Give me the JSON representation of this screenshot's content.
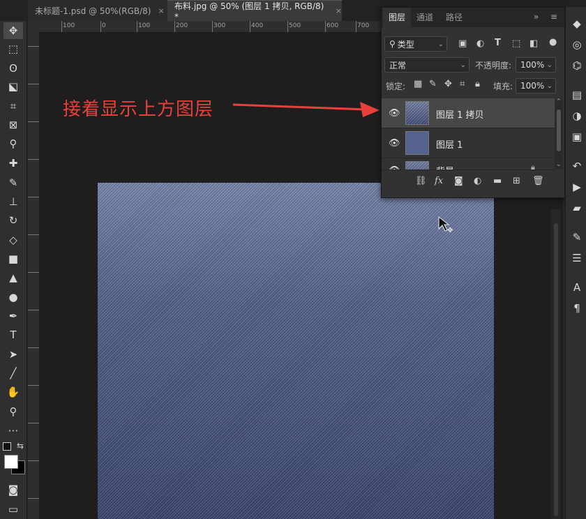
{
  "tabs": [
    {
      "label": "未标题-1.psd @ 50%(RGB/8)",
      "close": "×"
    },
    {
      "label": "布料.jpg @ 50% (图层 1 拷贝, RGB/8) *",
      "close": "×"
    }
  ],
  "ruler_labels": [
    "100",
    "0",
    "100",
    "200",
    "300",
    "400",
    "500",
    "600",
    "700"
  ],
  "annotation": "接着显示上方图层",
  "colors": {
    "annotation": "#e8403a",
    "denim_top": "#7b88b0",
    "denim_bottom": "#3d4773"
  },
  "layers_panel": {
    "tabs": [
      "图层",
      "通道",
      "路径"
    ],
    "filter": {
      "label": "类型"
    },
    "blend_mode": "正常",
    "opacity_label": "不透明度:",
    "opacity_value": "100%",
    "lock_label": "锁定:",
    "fill_label": "填充:",
    "fill_value": "100%",
    "layers": [
      {
        "name": "图层 1 拷贝",
        "selected": true
      },
      {
        "name": "图层 1",
        "selected": false
      },
      {
        "name": "背景",
        "selected": false
      }
    ],
    "bottom_icons": [
      "link-icon",
      "fx-icon",
      "mask-icon",
      "adjustment-icon",
      "folder-icon",
      "new-layer-icon",
      "trash-icon"
    ]
  }
}
